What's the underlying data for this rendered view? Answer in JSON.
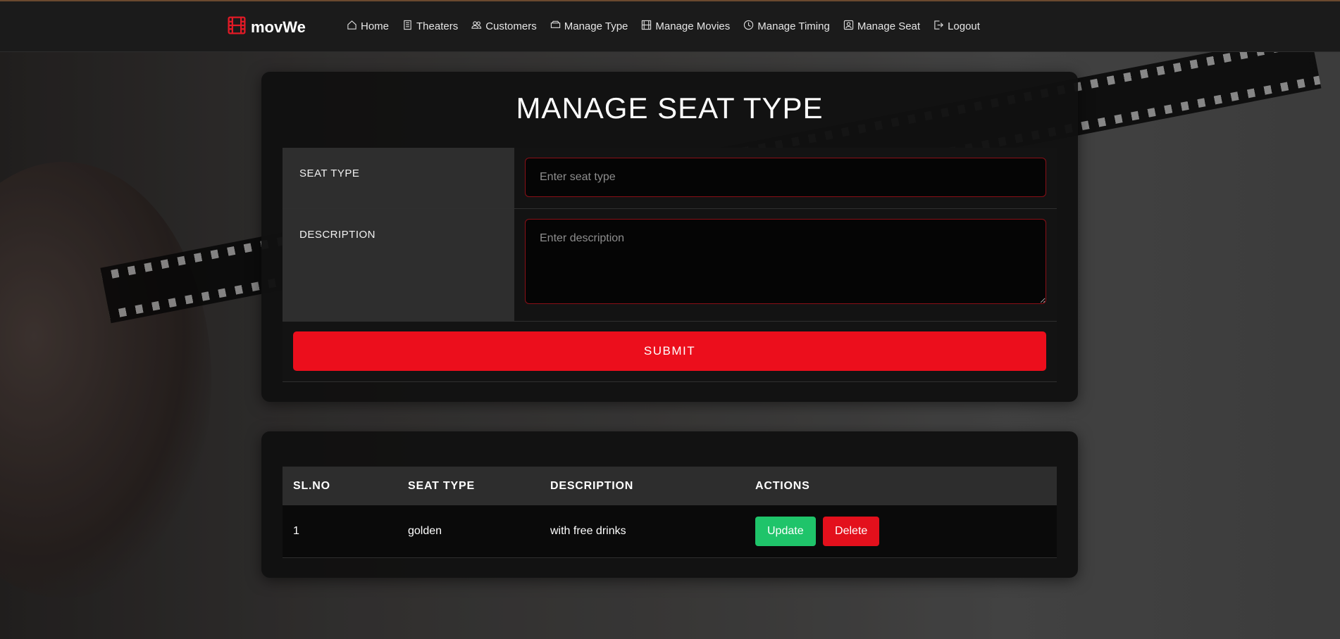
{
  "brand": {
    "name": "movWe",
    "icon": "film-icon",
    "accent": "#e21a26"
  },
  "nav": {
    "items": [
      {
        "label": "Home",
        "icon": "home-icon"
      },
      {
        "label": "Theaters",
        "icon": "building-icon"
      },
      {
        "label": "Customers",
        "icon": "users-icon"
      },
      {
        "label": "Manage Type",
        "icon": "ticket-icon"
      },
      {
        "label": "Manage Movies",
        "icon": "film-icon"
      },
      {
        "label": "Manage Timing",
        "icon": "clock-icon"
      },
      {
        "label": "Manage Seat",
        "icon": "person-square-icon"
      },
      {
        "label": "Logout",
        "icon": "logout-icon"
      }
    ]
  },
  "form": {
    "title": "MANAGE SEAT TYPE",
    "seat_type_label": "SEAT TYPE",
    "seat_type_placeholder": "Enter seat type",
    "description_label": "DESCRIPTION",
    "description_placeholder": "Enter description",
    "submit_label": "SUBMIT"
  },
  "table": {
    "headers": [
      "SL.NO",
      "SEAT TYPE",
      "DESCRIPTION",
      "ACTIONS"
    ],
    "rows": [
      {
        "sl": "1",
        "seat_type": "golden",
        "description": "with free drinks",
        "update_label": "Update",
        "delete_label": "Delete"
      }
    ]
  },
  "colors": {
    "submit": "#ec0e1c",
    "update": "#1fc46a",
    "delete": "#e3101c",
    "input_border": "#8a0f17"
  }
}
